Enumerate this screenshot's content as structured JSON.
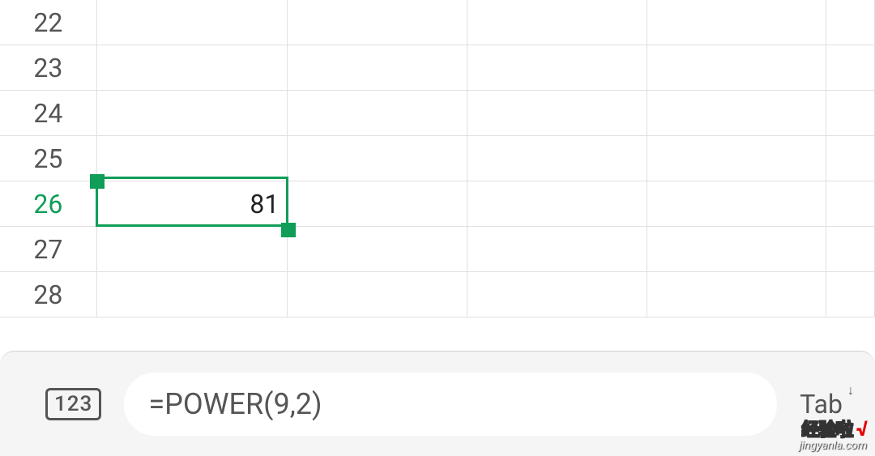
{
  "rows": {
    "r22": "22",
    "r23": "23",
    "r24": "24",
    "r25": "25",
    "r26": "26",
    "r27": "27",
    "r28": "28"
  },
  "activeCell": {
    "value": "81"
  },
  "formulaBar": {
    "numToggle": "123",
    "formula": "=POWER(9,2)",
    "tabLabel": "Tab"
  },
  "watermark": {
    "line1": "经验啦",
    "check": "√",
    "line2": "jingyanla.com"
  }
}
